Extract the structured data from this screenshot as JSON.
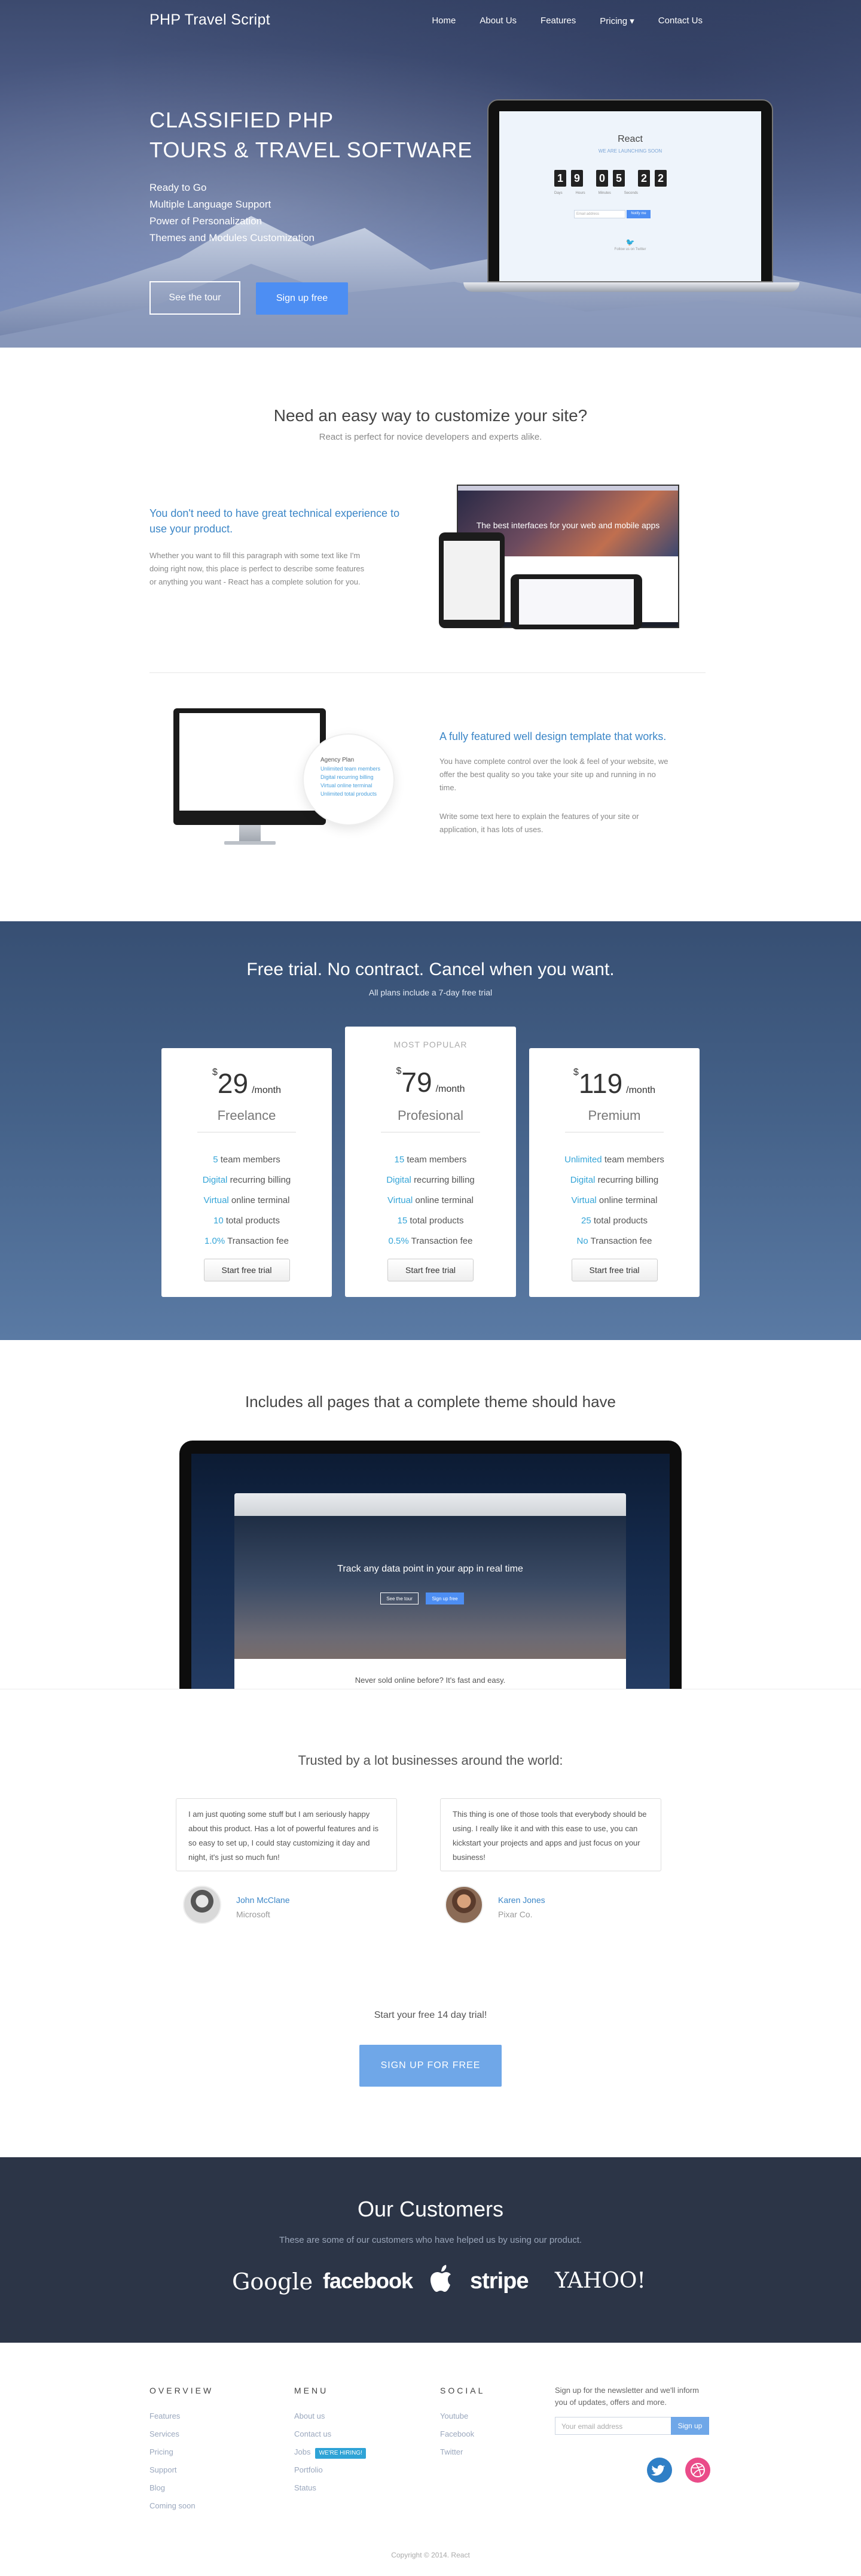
{
  "nav": {
    "brand": "PHP Travel Script",
    "items": [
      "Home",
      "About Us",
      "Features",
      "Pricing ▾",
      "Contact Us"
    ]
  },
  "hero": {
    "title_line1": "CLASSIFIED PHP",
    "title_line2": "TOURS & TRAVEL SOFTWARE",
    "features": [
      "Ready to Go",
      "Multiple Language Support",
      "Power of Personalization",
      "Themes and Modules Customization"
    ],
    "tour_button": "See the tour",
    "signup_button": "Sign up free",
    "screen": {
      "title": "React",
      "subtitle": "WE ARE LAUNCHING SOON",
      "digits": [
        "1",
        "9",
        "0",
        "5",
        "2",
        "2"
      ],
      "labels": [
        "Days",
        "Hours",
        "Minutes",
        "Seconds"
      ],
      "email_placeholder": "Email address",
      "submit": "Notify me",
      "tweet": "Follow us on Twitter"
    }
  },
  "customize": {
    "title": "Need an easy way to customize your site?",
    "subtitle": "React is perfect for novice developers and experts alike.",
    "block1_title": "You don't need to have great technical experience to use your product.",
    "block1_text": "Whether you want to fill this paragraph with some text like I'm doing right now, this place is perfect to describe some features or anything you want - React has a complete solution for you.",
    "devices_headline": "The best interfaces for your web and mobile apps",
    "block2_title": "A fully featured well design template that works.",
    "block2_text1": "You have complete control over the look & feel of your website, we offer the best quality so you take your site up and running in no time.",
    "block2_text2": "Write some text here to explain the features of your site or application, it has lots of uses.",
    "zoom_title": "Agency Plan",
    "zoom_items": [
      "Unlimited team members",
      "Digital recurring billing",
      "Virtual online terminal",
      "Unlimited total products"
    ]
  },
  "pricing": {
    "title": "Free trial. No contract. Cancel when you want.",
    "subtitle": "All plans include a 7-day free trial",
    "popular_label": "MOST POPULAR",
    "per": "/month",
    "cta": "Start free trial",
    "plans": [
      {
        "price": "29",
        "name": "Freelance",
        "features": [
          [
            "5",
            "team members"
          ],
          [
            "Digital",
            "recurring billing"
          ],
          [
            "Virtual",
            "online terminal"
          ],
          [
            "10",
            "total products"
          ],
          [
            "1.0%",
            "Transaction fee"
          ]
        ]
      },
      {
        "price": "79",
        "name": "Profesional",
        "features": [
          [
            "15",
            "team members"
          ],
          [
            "Digital",
            "recurring billing"
          ],
          [
            "Virtual",
            "online terminal"
          ],
          [
            "15",
            "total products"
          ],
          [
            "0.5%",
            "Transaction fee"
          ]
        ]
      },
      {
        "price": "119",
        "name": "Premium",
        "features": [
          [
            "Unlimited",
            "team members"
          ],
          [
            "Digital",
            "recurring billing"
          ],
          [
            "Virtual",
            "online terminal"
          ],
          [
            "25",
            "total products"
          ],
          [
            "No",
            "Transaction fee"
          ]
        ]
      }
    ]
  },
  "theme": {
    "title": "Includes all pages that a complete theme should have",
    "browser_headline": "Track any data point in your app in real time",
    "browser_btn1": "See the tour",
    "browser_btn2": "Sign up free",
    "footer_text": "Never sold online before? It's fast and easy."
  },
  "testimonials": {
    "title": "Trusted by a lot businesses around the world:",
    "items": [
      {
        "quote": "I am just quoting some stuff but I am seriously happy about this product. Has a lot of powerful features and is so easy to set up, I could stay customizing it day and night, it's just so much fun!",
        "name": "John McClane",
        "company": "Microsoft"
      },
      {
        "quote": "This thing is one of those tools that everybody should be using. I really like it and with this ease to use, you can kickstart your projects and apps and just focus on your business!",
        "name": "Karen Jones",
        "company": "Pixar Co."
      }
    ]
  },
  "cta": {
    "text": "Start your free 14 day trial!",
    "button": "SIGN UP FOR FREE"
  },
  "customers": {
    "title": "Our Customers",
    "subtitle": "These are some of our customers who have helped us by using our product.",
    "logos": [
      "Google",
      "facebook",
      "apple-icon",
      "stripe",
      "YAHOO!"
    ]
  },
  "footer": {
    "overview_title": "OVERVIEW",
    "overview_items": [
      "Features",
      "Services",
      "Pricing",
      "Support",
      "Blog",
      "Coming soon"
    ],
    "menu_title": "MENU",
    "menu_items": [
      "About us",
      "Contact us",
      "Jobs",
      "Portfolio",
      "Status"
    ],
    "hire_badge": "WE'RE HIRING!",
    "social_title": "SOCIAL",
    "social_items": [
      "Youtube",
      "Facebook",
      "Twitter"
    ],
    "newsletter_text": "Sign up for the newsletter and we'll inform you of updates, offers and more.",
    "email_placeholder": "Your email address",
    "signup": "Sign up",
    "copyright": "Copyright © 2014. React"
  },
  "colors": {
    "accent": "#4d8ef3",
    "link": "#3b86c7",
    "pricing_bg": "#446188",
    "customers_bg": "#2c3547",
    "twitter": "#2f7fc6",
    "dribbble": "#ea4c89"
  }
}
